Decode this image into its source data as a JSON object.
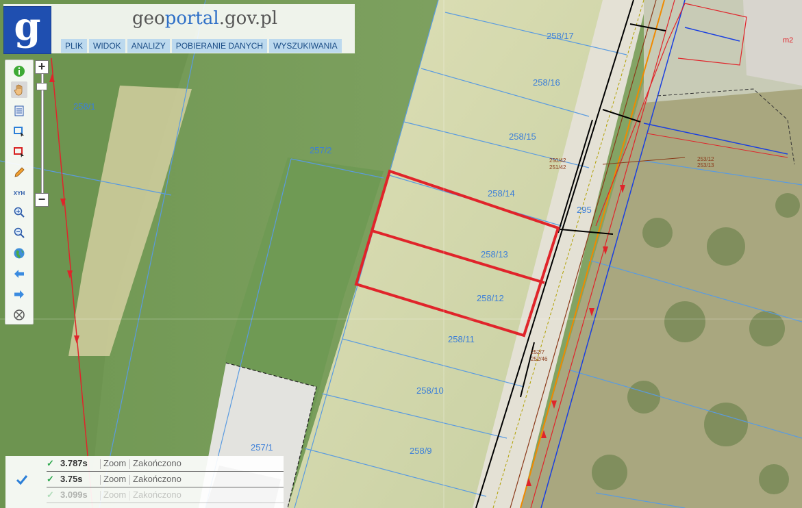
{
  "header": {
    "logo_letter": "g",
    "brand": {
      "part1": "geo",
      "part2": "portal",
      "part3": ".gov.pl"
    },
    "menu": [
      "PLIK",
      "WIDOK",
      "ANALIZY",
      "POBIERANIE DANYCH",
      "WYSZUKIWANIA"
    ]
  },
  "zoom": {
    "plus": "+",
    "minus": "−"
  },
  "toolbar": {
    "tools": [
      "info-icon",
      "pan-hand-icon",
      "legend-icon",
      "select-rectangle-icon",
      "select-rectangle-red-icon",
      "measure-pencil-icon",
      "xyh-coordinates-icon",
      "zoom-in-icon",
      "zoom-out-icon",
      "globe-icon",
      "back-arrow-icon",
      "forward-arrow-icon",
      "clear-icon"
    ],
    "xyh_label": "XYH"
  },
  "map": {
    "parcels": [
      {
        "label": "258/17"
      },
      {
        "label": "258/16"
      },
      {
        "label": "258/15"
      },
      {
        "label": "258/14"
      },
      {
        "label": "258/13"
      },
      {
        "label": "258/12"
      },
      {
        "label": "258/11"
      },
      {
        "label": "258/10"
      },
      {
        "label": "258/9"
      },
      {
        "label": "257/1"
      },
      {
        "label": "258/1"
      },
      {
        "label": "257/2"
      },
      {
        "label": "295"
      },
      {
        "label": "m2"
      }
    ],
    "small_labels": [
      "250/42",
      "251/42",
      "252/7",
      "252/46",
      "253/12",
      "253/13"
    ],
    "highlight_color": "#e0242a",
    "boundary_color": "#5a9be0"
  },
  "status": {
    "rows": [
      {
        "ok": "✓",
        "time": "3.787s",
        "type": "Zoom",
        "state": "Zakończono"
      },
      {
        "ok": "✓",
        "time": "3.75s",
        "type": "Zoom",
        "state": "Zakończono"
      },
      {
        "ok": "✓",
        "time": "3.099s",
        "type": "Zoom",
        "state": "Zakończono"
      }
    ]
  }
}
